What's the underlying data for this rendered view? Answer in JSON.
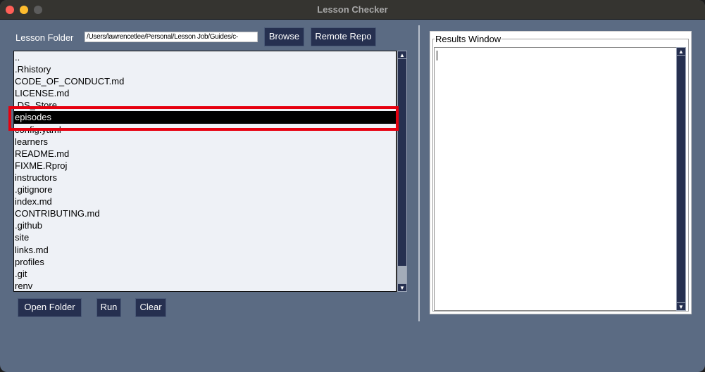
{
  "window": {
    "title": "Lesson Checker"
  },
  "left_panel": {
    "folder_label": "Lesson Folder",
    "folder_path": "/Users/lawrencetlee/Personal/Lesson Job/Guides/c-",
    "browse_label": "Browse",
    "remote_repo_label": "Remote Repo",
    "file_list": [
      "..",
      ".Rhistory",
      "CODE_OF_CONDUCT.md",
      "LICENSE.md",
      ".DS_Store",
      "episodes",
      "config.yaml",
      "learners",
      "README.md",
      "FIXME.Rproj",
      "instructors",
      ".gitignore",
      "index.md",
      "CONTRIBUTING.md",
      ".github",
      "site",
      "links.md",
      "profiles",
      ".git",
      "renv"
    ],
    "selected_item": "episodes",
    "scroll_position_fraction": 1.0,
    "open_folder_label": "Open Folder",
    "run_label": "Run",
    "clear_label": "Clear"
  },
  "right_panel": {
    "results_title": "Results Window",
    "results_text": ""
  },
  "colors": {
    "window_bg": "#5b6b83",
    "button_bg": "#263050",
    "selection_bg": "#000000",
    "highlight": "#e6000f"
  }
}
